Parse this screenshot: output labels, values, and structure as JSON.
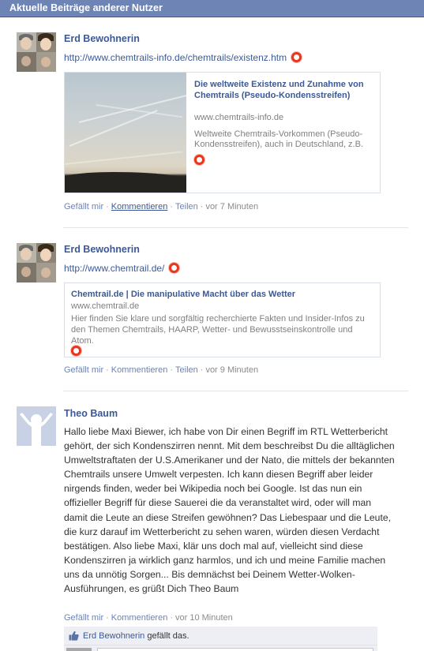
{
  "header": {
    "title": "Aktuelle Beiträge anderer Nutzer"
  },
  "posts": [
    {
      "author": "Erd Bewohnerin",
      "url": "http://www.chemtrails-info.de/chemtrails/existenz.htm",
      "attachment": {
        "title": "Die weltweite Existenz und Zunahme von Chemtrails (Pseudo-Kondensstreifen)",
        "domain": "www.chemtrails-info.de",
        "description": "Weltweite Chemtrails-Vorkommen (Pseudo-Kondensstreifen), auch in Deutschland, z.B."
      },
      "actions": {
        "like": "Gefällt mir",
        "comment": "Kommentieren",
        "share": "Teilen",
        "time": "vor 7 Minuten"
      }
    },
    {
      "author": "Erd Bewohnerin",
      "url": "http://www.chemtrail.de/",
      "attachment": {
        "title": "Chemtrail.de | Die manipulative Macht über das Wetter",
        "domain": "www.chemtrail.de",
        "description": "Hier finden Sie klare und sorgfältig recherchierte Fakten und Insider-Infos zu den Themen Chemtrails, HAARP, Wetter- und Bewusstseinskontrolle und Atom."
      },
      "actions": {
        "like": "Gefällt mir",
        "comment": "Kommentieren",
        "share": "Teilen",
        "time": "vor 9 Minuten"
      }
    },
    {
      "author": "Theo Baum",
      "text": "Hallo liebe Maxi Biewer, ich habe von Dir einen Begriff im RTL Wetterbericht gehört, der sich Kondenszirren nennt. Mit dem beschreibst Du die alltäglichen Umweltstraftaten der U.S.Amerikaner und der Nato, die mittels der bekannten Chemtrails unsere Umwelt verpesten. Ich kann diesen Begriff aber leider nirgends finden, weder bei Wikipedia noch bei Google. Ist das nun ein offizieller Begriff für diese Sauerei die da veranstaltet wird, oder will man damit die Leute an diese Streifen gewöhnen? Das Liebespaar und die Leute, die kurz darauf im Wetterbericht zu sehen waren, würden diesen Verdacht bestätigen. Also liebe Maxi, klär uns doch mal auf, vielleicht sind diese Kondenszirren ja wirklich ganz harmlos, und ich und meine Familie machen uns da unnötig Sorgen... Bis demnächst bei Deinem Wetter-Wolken-Ausführungen, es grüßt Dich Theo Baum",
      "actions": {
        "like": "Gefällt mir",
        "comment": "Kommentieren",
        "time": "vor 10 Minuten"
      },
      "likes": {
        "liker": "Erd Bewohnerin",
        "suffix": "gefällt das."
      }
    }
  ],
  "icons": {
    "feed": "rss-feed-icon",
    "like": "thumbs-up-icon"
  },
  "colors": {
    "header_bg": "#6d84b4",
    "link": "#3b5998",
    "feed_icon": "#e8361f",
    "like_bar": "#edeff4"
  }
}
